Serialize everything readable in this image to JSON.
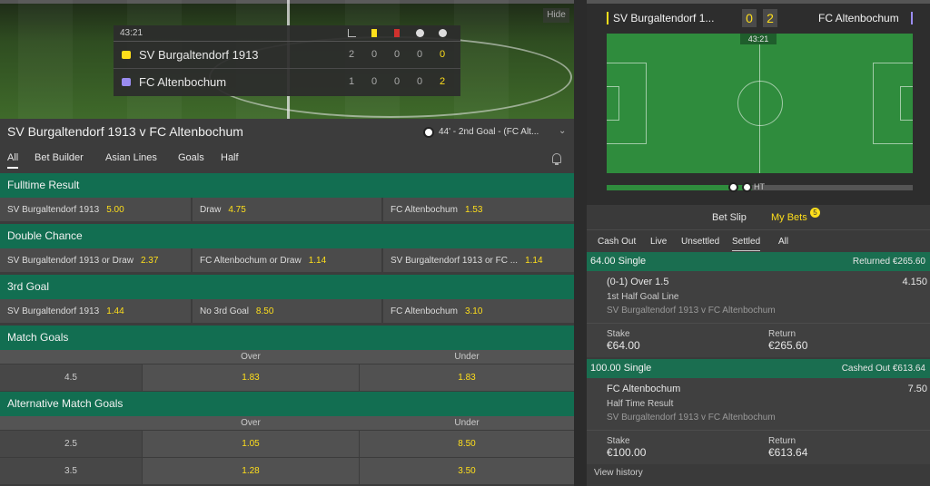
{
  "video": {
    "hide_label": "Hide"
  },
  "scoreboard": {
    "clock": "43:21",
    "teams": [
      {
        "name": "SV Burgaltendorf 1913",
        "stats": [
          "2",
          "0",
          "0",
          "0"
        ],
        "score": "0"
      },
      {
        "name": "FC Altenbochum",
        "stats": [
          "1",
          "0",
          "0",
          "0"
        ],
        "score": "2"
      }
    ]
  },
  "match": {
    "title": "SV Burgaltendorf 1913 v FC Altenbochum",
    "last_event": "44' - 2nd Goal - (FC Alt..."
  },
  "tabs": [
    "All",
    "Bet Builder",
    "Asian Lines",
    "Goals",
    "Half"
  ],
  "markets": {
    "fulltime": {
      "title": "Fulltime Result",
      "sels": [
        {
          "name": "SV Burgaltendorf 1913",
          "odds": "5.00"
        },
        {
          "name": "Draw",
          "odds": "4.75"
        },
        {
          "name": "FC Altenbochum",
          "odds": "1.53"
        }
      ]
    },
    "double": {
      "title": "Double Chance",
      "sels": [
        {
          "name": "SV Burgaltendorf 1913 or Draw",
          "odds": "2.37"
        },
        {
          "name": "FC Altenbochum or Draw",
          "odds": "1.14"
        },
        {
          "name": "SV Burgaltendorf 1913 or FC ...",
          "odds": "1.14"
        }
      ]
    },
    "third": {
      "title": "3rd Goal",
      "sels": [
        {
          "name": "SV Burgaltendorf 1913",
          "odds": "1.44"
        },
        {
          "name": "No 3rd Goal",
          "odds": "8.50"
        },
        {
          "name": "FC Altenbochum",
          "odds": "3.10"
        }
      ]
    },
    "match_goals": {
      "title": "Match Goals",
      "over": "Over",
      "under": "Under",
      "rows": [
        {
          "line": "4.5",
          "over": "1.83",
          "under": "1.83"
        }
      ]
    },
    "alt_goals": {
      "title": "Alternative Match Goals",
      "over": "Over",
      "under": "Under",
      "rows": [
        {
          "line": "2.5",
          "over": "1.05",
          "under": "8.50"
        },
        {
          "line": "3.5",
          "over": "1.28",
          "under": "3.50"
        }
      ]
    }
  },
  "pitch": {
    "home": "SV Burgaltendorf 1...",
    "away": "FC Altenbochum",
    "home_score": "0",
    "away_score": "2",
    "clock": "43:21",
    "ht_label": "HT"
  },
  "betslip": {
    "tab_slip": "Bet Slip",
    "tab_mybets": "My Bets",
    "mybets_count": "5",
    "filters": [
      "Cash Out",
      "Live",
      "Unsettled",
      "Settled",
      "All"
    ],
    "bets": [
      {
        "header": "64.00 Single",
        "status": "Returned €265.60",
        "selection": "(0-1) Over 1.5",
        "odds": "4.150",
        "market": "1st Half Goal Line",
        "event": "SV Burgaltendorf 1913 v FC Altenbochum",
        "stake_label": "Stake",
        "stake": "€64.00",
        "return_label": "Return",
        "return": "€265.60"
      },
      {
        "header": "100.00 Single",
        "status": "Cashed Out €613.64",
        "selection": "FC Altenbochum",
        "odds": "7.50",
        "market": "Half Time Result",
        "event": "SV Burgaltendorf 1913 v FC Altenbochum",
        "stake_label": "Stake",
        "stake": "€100.00",
        "return_label": "Return",
        "return": "€613.64"
      }
    ],
    "view_history": "View history"
  },
  "colors": {
    "accent_green": "#126e51",
    "odds_yellow": "#ffdf1b",
    "pitch_green": "#2f8c3d"
  }
}
